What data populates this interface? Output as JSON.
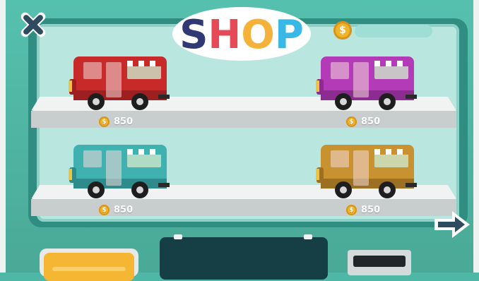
{
  "shop": {
    "title": "SHOP",
    "title_letters": [
      {
        "char": "S",
        "color": "#2f3a74"
      },
      {
        "char": "H",
        "color": "#e64a56"
      },
      {
        "char": "O",
        "color": "#f4b23a"
      },
      {
        "char": "P",
        "color": "#39b8e6"
      }
    ],
    "coin_symbol": "$",
    "items": [
      {
        "price": "850",
        "color": "#c82a2a",
        "dark": "#9e1f1f"
      },
      {
        "price": "850",
        "color": "#b33bb8",
        "dark": "#8c2b90"
      },
      {
        "price": "850",
        "color": "#3fb1b1",
        "dark": "#2f8b8b"
      },
      {
        "price": "850",
        "color": "#c7922f",
        "dark": "#9c7022"
      }
    ]
  },
  "icons": {
    "close": "close-icon",
    "next": "arrow-right-icon",
    "coin": "coin-icon"
  }
}
